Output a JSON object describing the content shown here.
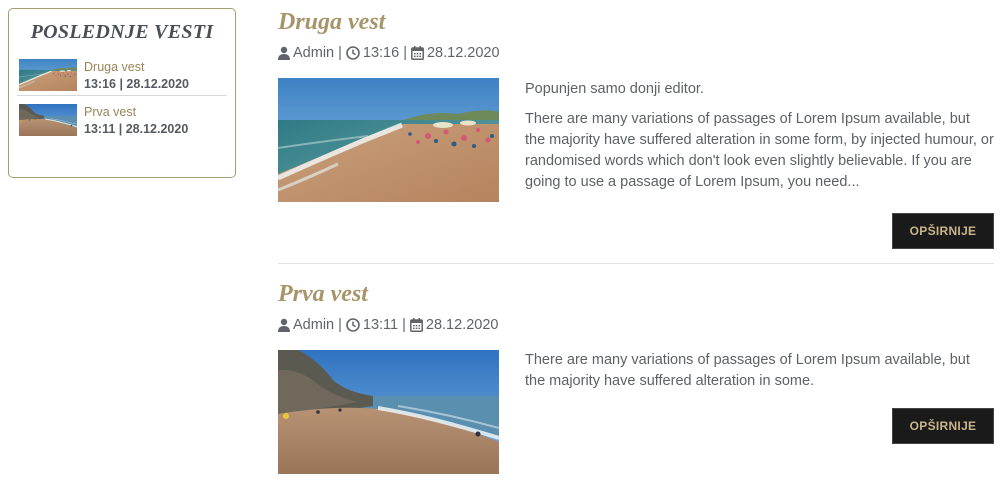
{
  "sidebar": {
    "title": "POSLEDNJE VESTI",
    "items": [
      {
        "title": "Druga vest",
        "meta": "13:16 | 28.12.2020",
        "image": "beach-thumbnail"
      },
      {
        "title": "Prva vest",
        "meta": "13:11 | 28.12.2020",
        "image": "cliff-beach-thumbnail"
      }
    ]
  },
  "articles": [
    {
      "title": "Druga vest",
      "author": "Admin",
      "time": "13:16",
      "date": "28.12.2020",
      "image": "beach-photo",
      "paragraphs": [
        "Popunjen samo donji editor.",
        "There are many variations of passages of Lorem Ipsum available, but the majority have suffered alteration in some form, by injected humour, or randomised words which don't look even slightly believable. If you are going to use a passage of Lorem Ipsum, you need..."
      ],
      "button": "OPŠIRNIJE"
    },
    {
      "title": "Prva vest",
      "author": "Admin",
      "time": "13:11",
      "date": "28.12.2020",
      "image": "cliff-beach-photo",
      "paragraphs": [
        "There are many variations of passages of Lorem Ipsum available, but the majority have suffered alteration in some."
      ],
      "button": "OPŠIRNIJE"
    }
  ],
  "icons": {
    "author": "user-icon",
    "time": "clock-icon",
    "date": "calendar-icon"
  },
  "colors": {
    "accent": "#a8946a",
    "button_bg": "#1a1a1a",
    "button_text": "#c9b58a",
    "text": "#5d6167",
    "sidebar_border": "#a89b74"
  }
}
